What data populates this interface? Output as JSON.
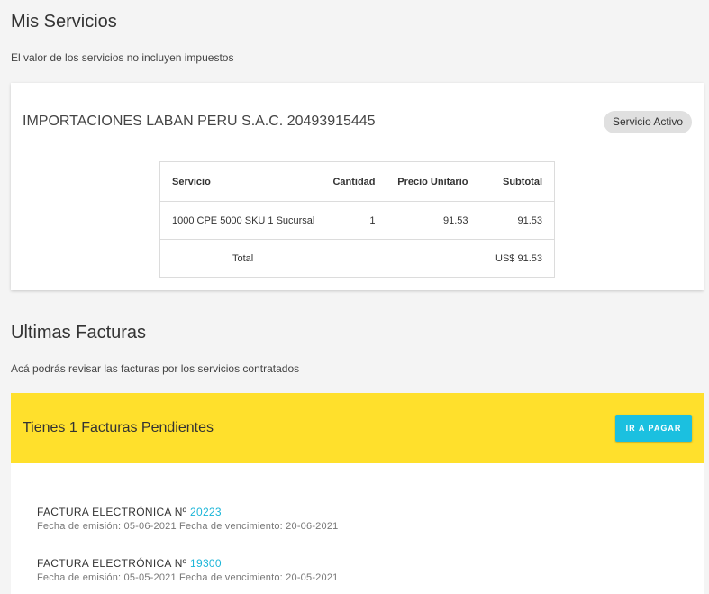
{
  "services": {
    "title": "Mis Servicios",
    "subtitle": "El valor de los servicios no incluyen impuestos",
    "company": "IMPORTACIONES LABAN PERU S.A.C. 20493915445",
    "badge": "Servicio Activo",
    "table": {
      "headers": [
        "Servicio",
        "Cantidad",
        "Precio Unitario",
        "Subtotal"
      ],
      "rows": [
        {
          "servicio": "1000 CPE 5000 SKU 1 Sucursal",
          "cantidad": "1",
          "precio": "91.53",
          "subtotal": "91.53"
        }
      ],
      "total_label": "Total",
      "total_value": "US$ 91.53"
    }
  },
  "invoices": {
    "title": "Ultimas Facturas",
    "subtitle": "Acá podrás revisar las facturas por los servicios contratados",
    "pending_text": "Tienes 1 Facturas Pendientes",
    "pay_button": "IR A PAGAR",
    "accent_color": "#ffe02c",
    "button_color": "#1bc0e0",
    "items": [
      {
        "label": "FACTURA ELECTRÓNICA Nº",
        "number": "20223",
        "dates": "Fecha de emisión: 05-06-2021 Fecha de vencimiento: 20-06-2021"
      },
      {
        "label": "FACTURA ELECTRÓNICA Nº",
        "number": "19300",
        "dates": "Fecha de emisión: 05-05-2021 Fecha de vencimiento: 20-05-2021"
      }
    ]
  }
}
